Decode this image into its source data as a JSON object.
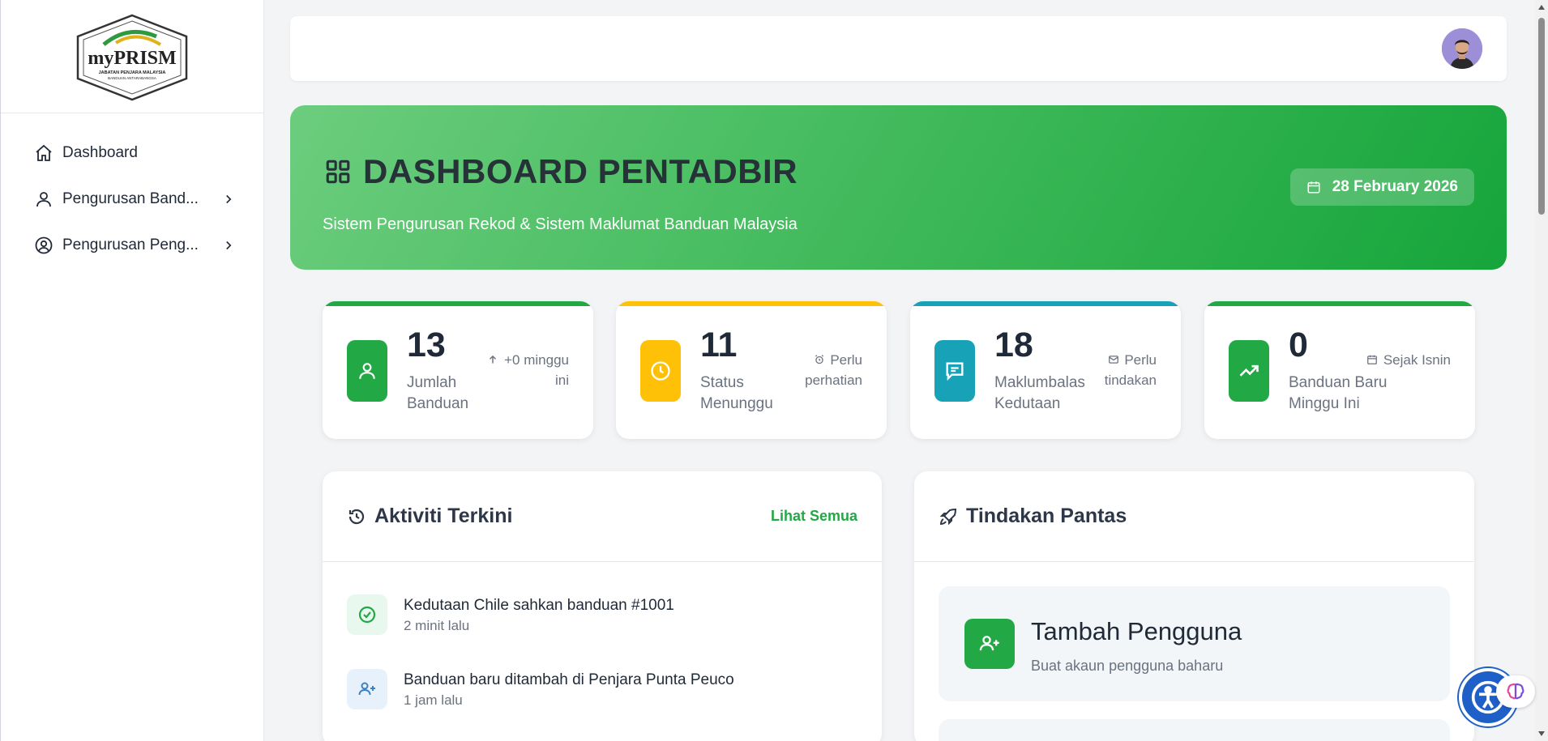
{
  "logo": {
    "brand": "myPRISM",
    "tagline": "JABATAN PENJARA MALAYSIA",
    "tagline2": "BANDUAN ANTARABANGSA"
  },
  "sidebar": {
    "items": [
      {
        "label": "Dashboard",
        "icon": "home-icon"
      },
      {
        "label": "Pengurusan Band...",
        "icon": "user-icon"
      },
      {
        "label": "Pengurusan Peng...",
        "icon": "user-circle-icon"
      }
    ]
  },
  "hero": {
    "title": "DASHBOARD PENTADBIR",
    "subtitle": "Sistem Pengurusan Rekod & Sistem Maklumat Banduan Malaysia",
    "date": "28 February 2026"
  },
  "stats": [
    {
      "value": "13",
      "label": "Jumlah Banduan",
      "note": "+0 minggu ini",
      "color": "#22a845",
      "icon": "user-icon",
      "note_icon": "arrow-up-icon"
    },
    {
      "value": "11",
      "label": "Status Menunggu",
      "note": "Perlu perhatian",
      "color": "#ffc107",
      "icon": "clock-icon",
      "note_icon": "alarm-icon"
    },
    {
      "value": "18",
      "label": "Maklumbalas Kedutaan",
      "note": "Perlu tindakan",
      "color": "#17a2b8",
      "icon": "chat-icon",
      "note_icon": "mail-icon"
    },
    {
      "value": "0",
      "label": "Banduan Baru Minggu Ini",
      "note": "Sejak Isnin",
      "color": "#22a845",
      "icon": "trend-up-icon",
      "note_icon": "calendar-icon"
    }
  ],
  "activity": {
    "title": "Aktiviti Terkini",
    "link": "Lihat Semua",
    "items": [
      {
        "text": "Kedutaan Chile sahkan banduan #1001",
        "time": "2 minit lalu",
        "icon": "check-circle-icon"
      },
      {
        "text": "Banduan baru ditambah di Penjara Punta Peuco",
        "time": "1 jam lalu",
        "icon": "user-plus-icon"
      }
    ]
  },
  "quick": {
    "title": "Tindakan Pantas",
    "items": [
      {
        "title": "Tambah Pengguna",
        "subtitle": "Buat akaun pengguna baharu",
        "icon": "user-plus-icon"
      }
    ]
  },
  "colors": {
    "accent": "#22a845",
    "warning": "#ffc107",
    "info": "#17a2b8"
  }
}
